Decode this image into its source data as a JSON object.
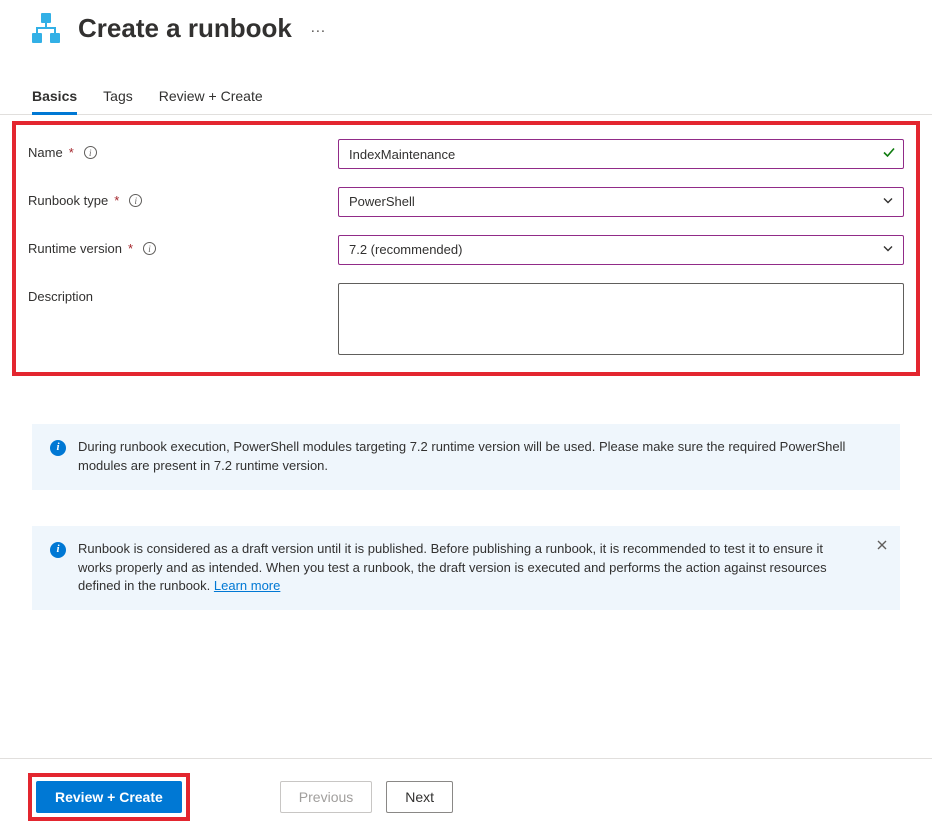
{
  "header": {
    "title": "Create a runbook",
    "more": "…"
  },
  "tabs": {
    "basics": "Basics",
    "tags": "Tags",
    "review": "Review + Create"
  },
  "form": {
    "name_label": "Name",
    "name_value": "IndexMaintenance",
    "type_label": "Runbook type",
    "type_value": "PowerShell",
    "version_label": "Runtime version",
    "version_value": "7.2 (recommended)",
    "desc_label": "Description",
    "desc_value": ""
  },
  "info1": "During runbook execution, PowerShell modules targeting 7.2 runtime version will be used. Please make sure the required PowerShell modules are present in 7.2 runtime version.",
  "info2_text": "Runbook is considered as a draft version until it is published. Before publishing a runbook, it is recommended to test it to ensure it works properly and as intended. When you test a runbook, the draft version is executed and performs the action against resources defined in the runbook. ",
  "info2_link": "Learn more",
  "buttons": {
    "review": "Review + Create",
    "previous": "Previous",
    "next": "Next"
  }
}
